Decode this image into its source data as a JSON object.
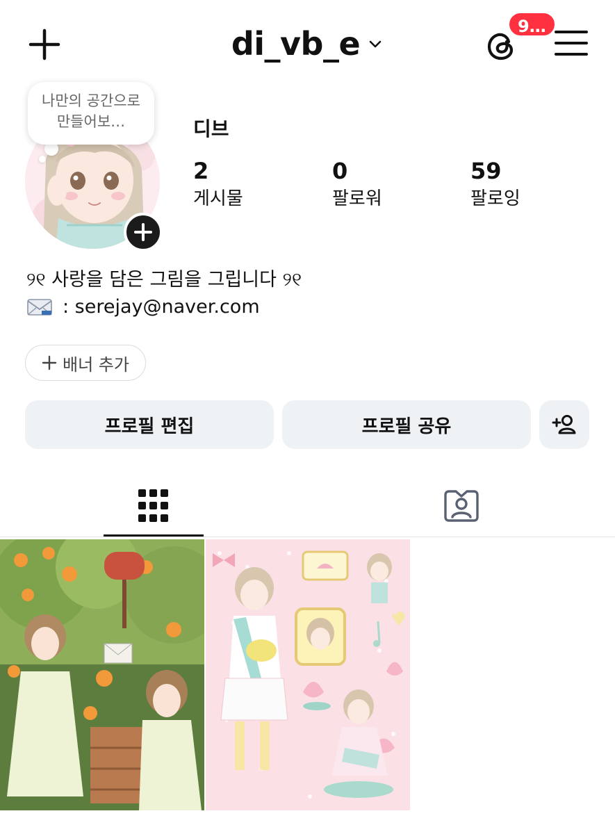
{
  "header": {
    "username": "di_vb_e",
    "notification_badge": "9…",
    "icons": {
      "create": "plus-icon",
      "switch_account": "chevron-down-icon",
      "threads": "threads-icon",
      "menu": "hamburger-menu-icon"
    }
  },
  "profile": {
    "note": "나만의 공간으로 만들어보…",
    "display_name": "디브",
    "stats": [
      {
        "value": "2",
        "label": "게시물"
      },
      {
        "value": "0",
        "label": "팔로워"
      },
      {
        "value": "59",
        "label": "팔로잉"
      }
    ],
    "bio_line1": "୨୧ 사랑을 담은 그림을 그립니다 ୨୧",
    "bio_line2": ": serejay@naver.com",
    "bio_icon": "envelope-icon"
  },
  "banner_chip": "배너 추가",
  "actions": {
    "edit_profile": "프로필 편집",
    "share_profile": "프로필 공유",
    "discover_people_icon": "add-person-icon"
  },
  "tabs": [
    {
      "name": "posts-grid",
      "icon": "grid-icon",
      "active": true
    },
    {
      "name": "tagged",
      "icon": "tagged-person-icon",
      "active": false
    }
  ],
  "posts": [
    {
      "kind": "illustration",
      "theme": "orange flowers, mailbox, two girls"
    },
    {
      "kind": "illustration",
      "theme": "pink sticker sheet, lotus, girl"
    }
  ],
  "colors": {
    "badge": "#ff3040",
    "button_bg": "#eff2f5",
    "text": "#111111",
    "muted": "#666666"
  }
}
